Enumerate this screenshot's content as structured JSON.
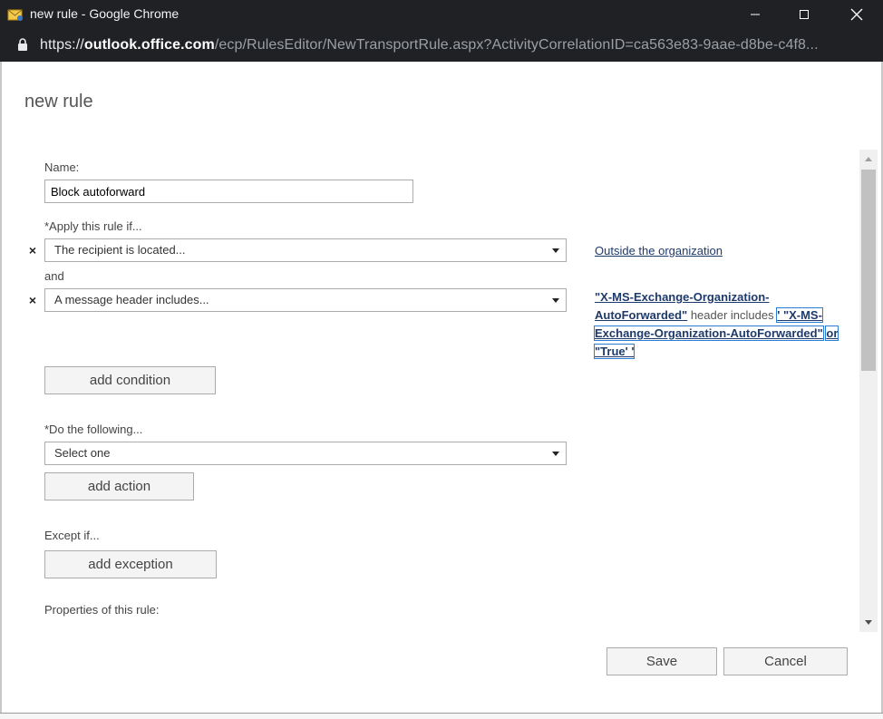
{
  "window": {
    "title": "new rule - Google Chrome",
    "controls": {
      "minimize": "—",
      "maximize": "☐",
      "close": "✕"
    }
  },
  "address_bar": {
    "scheme": "https://",
    "host": "outlook.office.com",
    "path": "/ecp/RulesEditor/NewTransportRule.aspx?ActivityCorrelationID=ca563e83-9aae-d8be-c4f8..."
  },
  "page": {
    "title": "new rule"
  },
  "form": {
    "name_label": "Name:",
    "name_value": "Block autoforward",
    "apply_label": "*Apply this rule if...",
    "condition1": {
      "remove": "×",
      "value": "The recipient is located...",
      "link": "Outside the organization"
    },
    "and_label": "and",
    "condition2": {
      "remove": "×",
      "value": "A message header includes...",
      "header_name": "\"X-MS-Exchange-Organization-AutoForwarded\"",
      "header_text": " header includes ",
      "header_values_part1": "' \"X-MS-Exchange-Organization-AutoForwarded\"",
      "header_values_part2": "or \"True' '"
    },
    "add_condition": "add condition",
    "do_label": "*Do the following...",
    "action_value": "Select one",
    "add_action": "add action",
    "except_label": "Except if...",
    "add_exception": "add exception",
    "properties_label": "Properties of this rule:"
  },
  "footer": {
    "save": "Save",
    "cancel": "Cancel"
  },
  "colors": {
    "titlebar": "#202124",
    "link": "#1e3a6b",
    "focus_outline": "#2b7cd3"
  }
}
